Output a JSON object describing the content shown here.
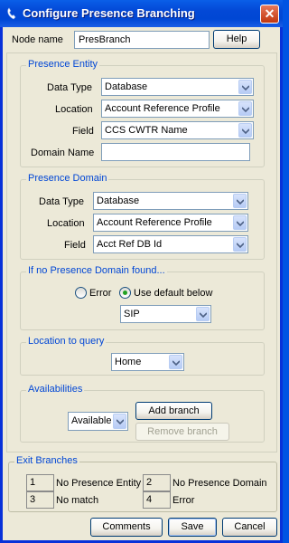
{
  "window": {
    "title": "Configure Presence Branching",
    "close_label": "✕"
  },
  "node": {
    "label": "Node name",
    "value": "PresBranch",
    "help": "Help"
  },
  "entity": {
    "title": "Presence Entity",
    "data_type_label": "Data Type",
    "data_type": "Database",
    "location_label": "Location",
    "location": "Account Reference Profile",
    "field_label": "Field",
    "field": "CCS CWTR Name",
    "domain_label": "Domain Name",
    "domain": ""
  },
  "domain": {
    "title": "Presence Domain",
    "data_type_label": "Data Type",
    "data_type": "Database",
    "location_label": "Location",
    "location": "Account Reference Profile",
    "field_label": "Field",
    "field": "Acct Ref DB Id"
  },
  "not_found": {
    "title": "If no Presence Domain found...",
    "error_label": "Error",
    "default_label": "Use default below",
    "selected": "default",
    "default_value": "SIP"
  },
  "query": {
    "title": "Location to query",
    "value": "Home"
  },
  "availabilities": {
    "title": "Availabilities",
    "value": "Available",
    "add_branch": "Add branch",
    "remove_branch": "Remove branch"
  },
  "exits": {
    "title": "Exit Branches",
    "items": [
      {
        "num": "1",
        "label": "No Presence Entity"
      },
      {
        "num": "2",
        "label": "No Presence Domain"
      },
      {
        "num": "3",
        "label": "No match"
      },
      {
        "num": "4",
        "label": "Error"
      }
    ]
  },
  "footer": {
    "comments": "Comments",
    "save": "Save",
    "cancel": "Cancel"
  },
  "colors": {
    "title_bar": "#0054e3",
    "group_title": "#0046d5",
    "dialog_bg": "#ece9d8"
  }
}
